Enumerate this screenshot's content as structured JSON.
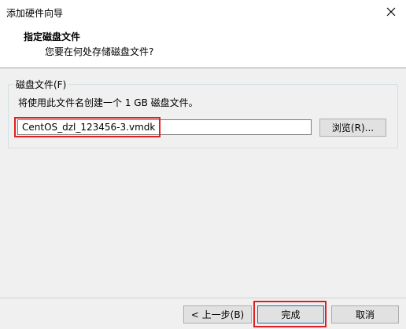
{
  "window": {
    "title": "添加硬件向导",
    "close_icon": "close-icon"
  },
  "header": {
    "title": "指定磁盘文件",
    "subtitle": "您要在何处存储磁盘文件?"
  },
  "disk_file": {
    "group_label": "磁盘文件(F)",
    "description": "将使用此文件名创建一个 1 GB 磁盘文件。",
    "filename": "CentOS_dzl_123456-3.vmdk",
    "browse_label": "浏览(R)..."
  },
  "footer": {
    "back_label": "< 上一步(B)",
    "finish_label": "完成",
    "cancel_label": "取消"
  },
  "colors": {
    "highlight": "#e02020",
    "focus_border": "#0078d7"
  }
}
